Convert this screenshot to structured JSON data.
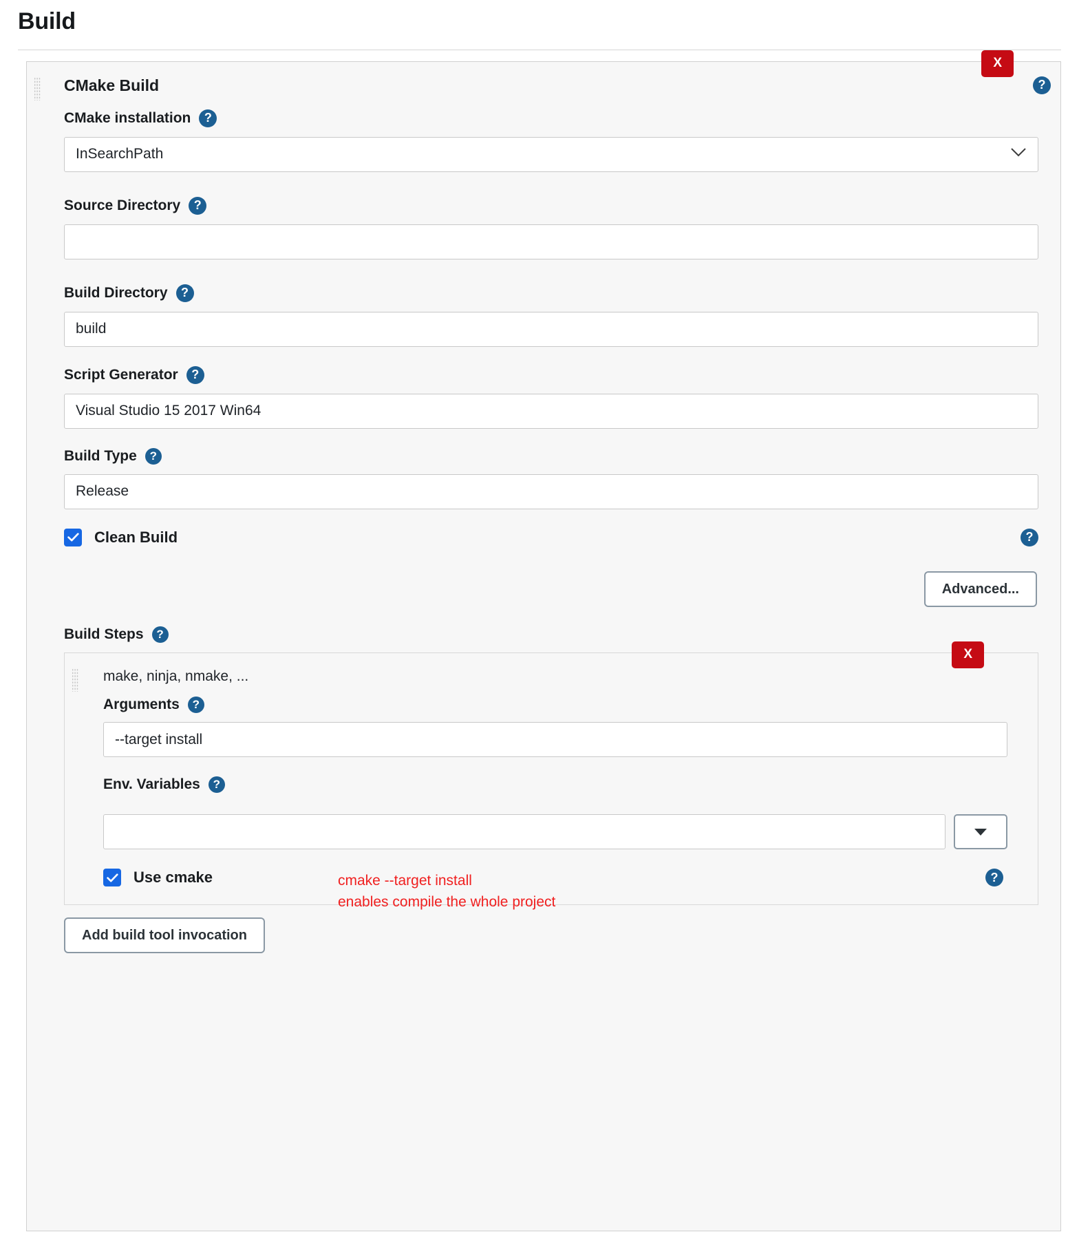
{
  "page": {
    "title": "Build"
  },
  "build_step": {
    "title": "CMake Build",
    "delete_label": "X",
    "help_label": "?",
    "fields": {
      "cmake_installation": {
        "label": "CMake installation",
        "value": "InSearchPath",
        "type": "select"
      },
      "source_directory": {
        "label": "Source Directory",
        "value": "",
        "placeholder": ""
      },
      "build_directory": {
        "label": "Build Directory",
        "value": "build",
        "placeholder": ""
      },
      "script_generator": {
        "label": "Script Generator",
        "value": "Visual Studio 15 2017 Win64",
        "placeholder": ""
      },
      "build_type": {
        "label": "Build Type",
        "value": "Release",
        "placeholder": ""
      },
      "clean_build": {
        "label": "Clean Build",
        "checked": true
      }
    },
    "advanced_button": "Advanced...",
    "build_steps": {
      "label": "Build Steps",
      "invocation": {
        "title": "make, ninja, nmake, ...",
        "delete_label": "X",
        "arguments": {
          "label": "Arguments",
          "value": "--target install",
          "placeholder": ""
        },
        "env_variables": {
          "label": "Env. Variables",
          "value": "",
          "placeholder": "",
          "dropdown_icon": "triangle-down-icon"
        },
        "use_cmake": {
          "label": "Use cmake",
          "checked": true
        }
      },
      "add_button": "Add build tool invocation"
    }
  },
  "annotation": {
    "line1": "cmake --target install",
    "line2": "enables compile the whole project",
    "color": "#f02020"
  },
  "icons": {
    "help": "help-circle-icon",
    "chevron_down": "chevron-down-icon",
    "drag_grip": "drag-grip-icon",
    "checkmark": "checkmark-icon"
  },
  "colors": {
    "delete": "#c50b14",
    "help": "#1c5f93",
    "checkbox": "#1667e3",
    "annotation": "#f02020",
    "button_border": "#8a98a4"
  }
}
